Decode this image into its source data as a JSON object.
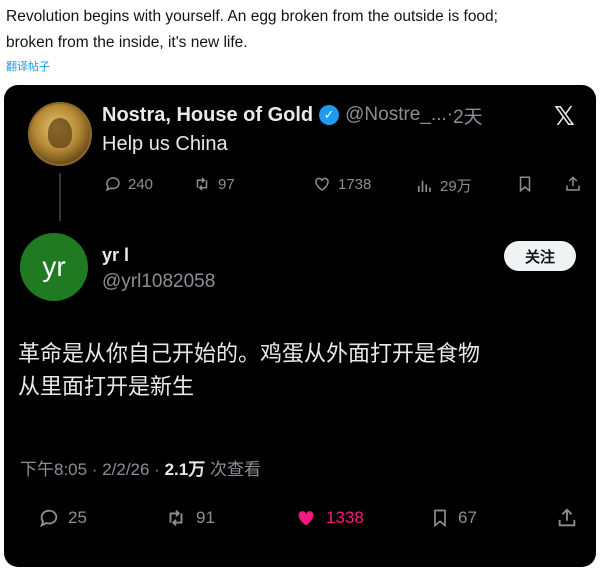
{
  "caption": {
    "line1": "Revolution begins with yourself. An egg broken from the outside is food;",
    "line2": "broken from the inside, it's new life.",
    "translate_link": "翻译帖子"
  },
  "original_post": {
    "author_name": "Nostra, House of Gold",
    "handle": "@Nostre_...",
    "separator": "·",
    "time": "2天",
    "text": "Help us China",
    "metrics": {
      "replies": "240",
      "reposts": "97",
      "likes": "1738",
      "views": "29万"
    },
    "icons": {
      "verified": "verified-badge-icon",
      "platform": "x-logo-icon"
    }
  },
  "reply_post": {
    "avatar_text": "yr",
    "author_name": "yr l",
    "handle": "@yrl1082058",
    "follow_label": "关注",
    "text_line1": "革命是从你自己开始的。鸡蛋从外面打开是食物",
    "text_line2": "从里面打开是新生",
    "timestamp": "下午8:05 · 2/2/26 ·",
    "views_count": "2.1万",
    "views_label": "次查看",
    "metrics": {
      "replies": "25",
      "reposts": "91",
      "likes": "1338",
      "bookmarks": "67"
    },
    "like_color": "#f91880"
  },
  "colors": {
    "card_background": "#000000",
    "accent": "#1d9bf0",
    "muted": "#8b8f94"
  }
}
